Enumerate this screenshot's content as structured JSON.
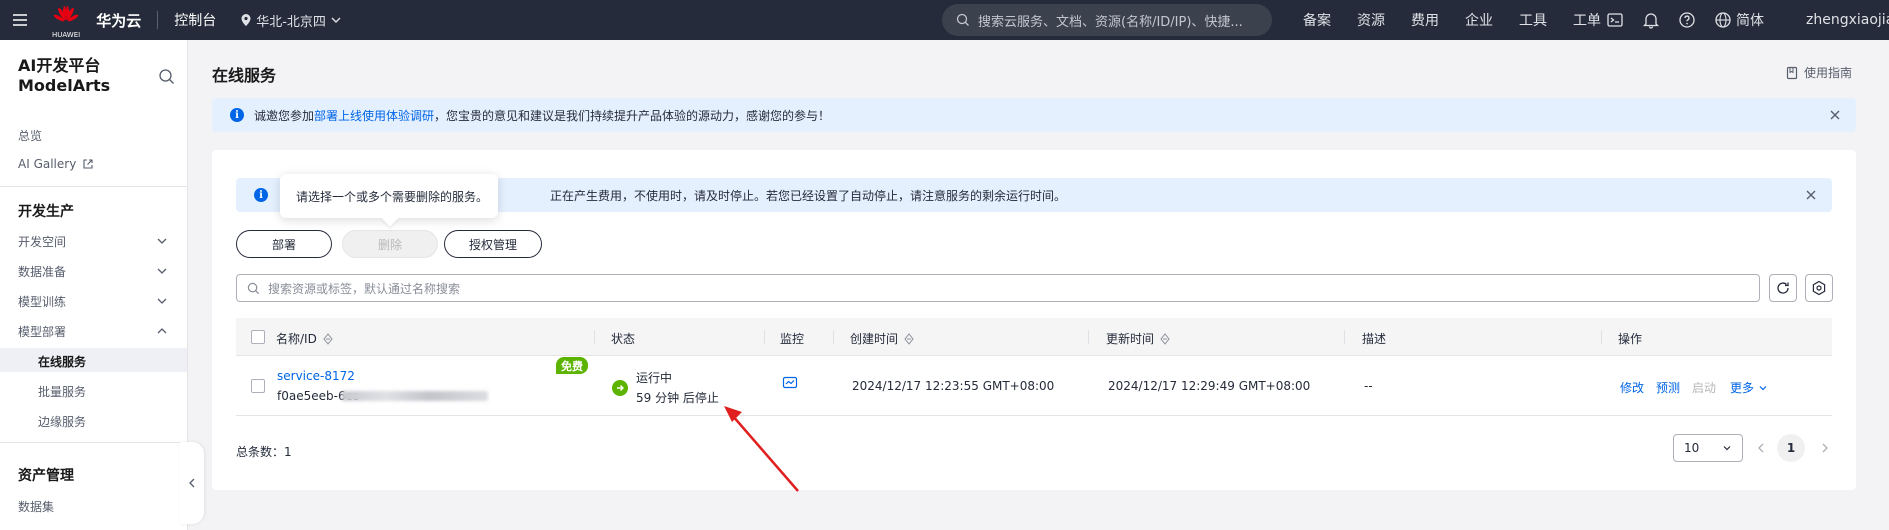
{
  "topbar": {
    "logo_label": "HUAWEI",
    "brand": "华为云",
    "console": "控制台",
    "region": "华北-北京四",
    "search_placeholder": "搜索云服务、文档、资源(名称/ID/IP)、快捷...",
    "links": [
      "备案",
      "资源",
      "费用",
      "企业",
      "工具",
      "工单"
    ],
    "lang": "简体",
    "user": "zhengxiaojiar"
  },
  "sidebar": {
    "title_line1": "AI开发平台",
    "title_line2": "ModelArts",
    "overview": "总览",
    "ai_gallery": "AI Gallery",
    "group_dev": "开发生产",
    "dev_space": "开发空间",
    "data_prep": "数据准备",
    "model_train": "模型训练",
    "model_deploy": "模型部署",
    "online_service": "在线服务",
    "batch_service": "批量服务",
    "edge_service": "边缘服务",
    "group_assets": "资产管理",
    "dataset": "数据集"
  },
  "main": {
    "title": "在线服务",
    "guide": "使用指南",
    "alert1_prefix": "诚邀您参加",
    "alert1_link": "部署上线使用体验调研",
    "alert1_suffix": "，您宝贵的意见和建议是我们持续提升产品体验的源动力，感谢您的参与！",
    "alert2_visible": "正在产生费用，不使用时，请及时停止。若您已经设置了自动停止，请注意服务的剩余运行时间。",
    "tooltip": "请选择一个或多个需要删除的服务。",
    "btn_deploy": "部署",
    "btn_delete": "删除",
    "btn_auth": "授权管理",
    "table_search_placeholder": "搜索资源或标签，默认通过名称搜索",
    "columns": [
      "名称/ID",
      "状态",
      "监控",
      "创建时间",
      "更新时间",
      "描述",
      "操作"
    ],
    "row": {
      "name": "service-8172",
      "id": "f0ae5eeb-6cc",
      "free_tag": "免费",
      "status": "运行中",
      "status_sub": "59 分钟 后停止",
      "created": "2024/12/17 12:23:55 GMT+08:00",
      "updated": "2024/12/17 12:29:49 GMT+08:00",
      "description": "--",
      "actions": [
        "修改",
        "预测",
        "启动",
        "更多"
      ]
    },
    "total": "总条数：1",
    "page_size": "10",
    "current_page": "1"
  },
  "colors": {
    "topbar": "#252b3a",
    "accent": "#0065e6",
    "running": "#5cb300",
    "annotation_arrow": "#e02020"
  }
}
